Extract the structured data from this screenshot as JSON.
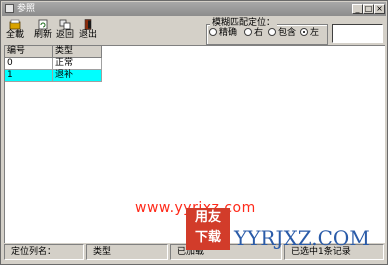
{
  "window": {
    "title": "参照"
  },
  "toolbar": [
    {
      "label": "全載",
      "icon": "load-all-icon"
    },
    {
      "label": "刷新",
      "icon": "refresh-icon"
    },
    {
      "label": "返回",
      "icon": "return-icon"
    },
    {
      "label": "退出",
      "icon": "exit-icon"
    }
  ],
  "fuzzy_match": {
    "legend": "模糊匹配定位：",
    "options": [
      "精确",
      "右",
      "包含",
      "左"
    ],
    "selected": "左"
  },
  "search": {
    "value": ""
  },
  "grid": {
    "columns": [
      "编号",
      "类型"
    ],
    "rows": [
      {
        "code": "0",
        "type": "正常"
      },
      {
        "code": "1",
        "type": "退补"
      }
    ],
    "selected_row": 1
  },
  "watermark": {
    "url": "www.yyrjxz.com",
    "logo": [
      "用友",
      "下载"
    ],
    "brand": "YYRJXZ.COM"
  },
  "status": {
    "locate_column": "定位列名：",
    "column_value": "类型",
    "loaded": "已加载",
    "selected": "已选中1条记录"
  },
  "colors": {
    "selection": "#00ffff",
    "face": "#d4d0c8",
    "watermark_red": "#ff2a1a",
    "watermark_blue": "#2a5ba8"
  }
}
